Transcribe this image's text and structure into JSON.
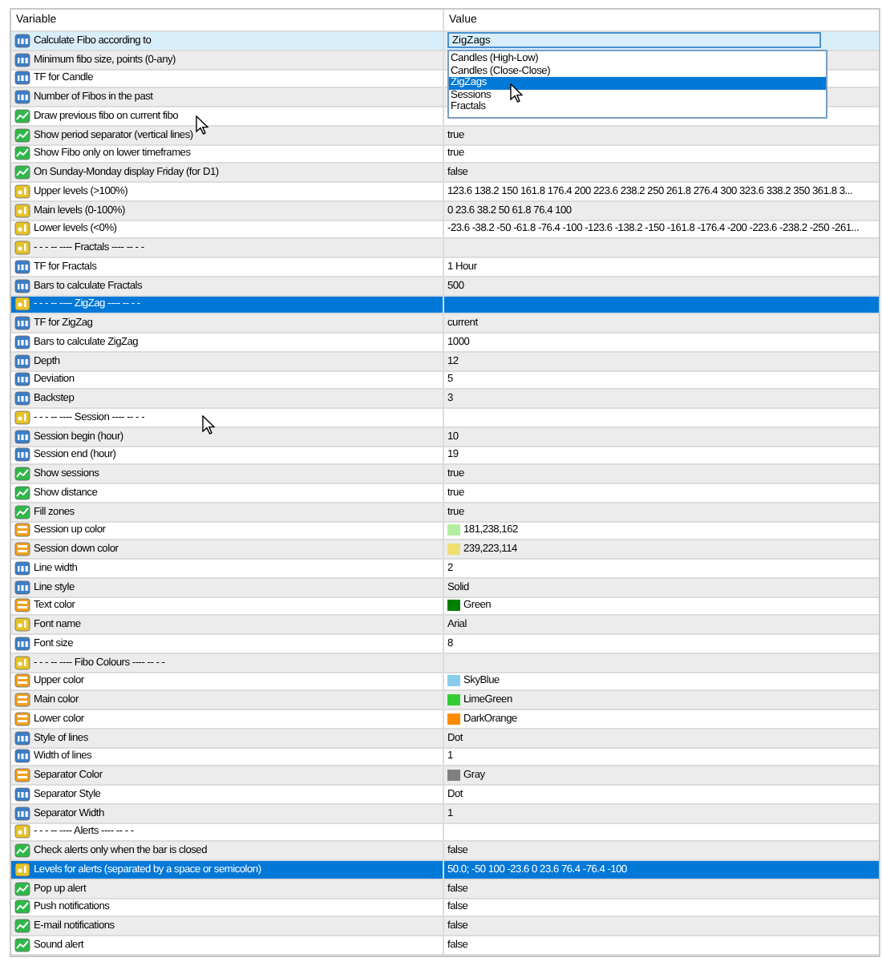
{
  "table": {
    "columns": [
      "Variable",
      "Value"
    ],
    "rows": [
      {
        "kind": "enum",
        "name": "Calculate Fibo according to",
        "selected": false,
        "dropdown": {
          "value": "ZigZags",
          "options": [
            {
              "label": "Candles (High-Low)",
              "selected": false
            },
            {
              "label": "Candles (Close-Close)",
              "selected": false
            },
            {
              "label": "ZigZags",
              "selected": true
            },
            {
              "label": "Sessions",
              "selected": false
            },
            {
              "label": "Fractals",
              "selected": false
            }
          ]
        }
      },
      {
        "kind": "int",
        "name": "Minimum fibo size, points (0-any)",
        "selected": false
      },
      {
        "kind": "enum",
        "name": "TF for Candle",
        "selected": false
      },
      {
        "kind": "int",
        "name": "Number of Fibos in the past",
        "selected": false
      },
      {
        "kind": "bool",
        "name": "Draw previous fibo on current fibo",
        "selected": false
      },
      {
        "kind": "bool",
        "name": "Show period separator (vertical lines)",
        "value": "true",
        "selected": false
      },
      {
        "kind": "bool",
        "name": "Show Fibo only on lower timeframes",
        "value": "true",
        "selected": false
      },
      {
        "kind": "bool",
        "name": "On Sunday-Monday display Friday (for D1)",
        "value": "false",
        "selected": false
      },
      {
        "kind": "str",
        "name": "Upper levels (>100%)",
        "value": "123.6 138.2 150 161.8 176.4 200 223.6 238.2 250 261.8 276.4 300 323.6 338.2 350 361.8 3...",
        "selected": false
      },
      {
        "kind": "str",
        "name": "Main levels (0-100%)",
        "value": "0 23.6 38.2 50 61.8 76.4 100",
        "selected": false
      },
      {
        "kind": "str",
        "name": "Lower levels (<0%)",
        "value": "-23.6 -38.2 -50 -61.8 -76.4 -100 -123.6 -138.2 -150 -161.8 -176.4 -200 -223.6 -238.2 -250 -261...",
        "selected": false
      },
      {
        "kind": "str",
        "name": "- - - -- ---- Fractals ---- -- - -",
        "selected": false
      },
      {
        "kind": "enum",
        "name": "TF for Fractals",
        "value": "1 Hour",
        "selected": false
      },
      {
        "kind": "int",
        "name": "Bars to calculate Fractals",
        "value": "500",
        "selected": false
      },
      {
        "kind": "str",
        "name": "- - - -- ---- ZigZag ---- -- - -",
        "selected": true
      },
      {
        "kind": "enum",
        "name": "TF for ZigZag",
        "value": "current",
        "selected": false
      },
      {
        "kind": "int",
        "name": "Bars to calculate ZigZag",
        "value": "1000",
        "selected": false
      },
      {
        "kind": "int",
        "name": "Depth",
        "value": "12",
        "selected": false
      },
      {
        "kind": "int",
        "name": "Deviation",
        "value": "5",
        "selected": false
      },
      {
        "kind": "int",
        "name": "Backstep",
        "value": "3",
        "selected": false
      },
      {
        "kind": "str",
        "name": "- - - -- ---- Session ---- -- - -",
        "selected": false
      },
      {
        "kind": "int",
        "name": "Session begin (hour)",
        "value": "10",
        "selected": false
      },
      {
        "kind": "int",
        "name": "Session end (hour)",
        "value": "19",
        "selected": false
      },
      {
        "kind": "bool",
        "name": "Show sessions",
        "value": "true",
        "selected": false
      },
      {
        "kind": "bool",
        "name": "Show distance",
        "value": "true",
        "selected": false
      },
      {
        "kind": "bool",
        "name": "Fill zones",
        "value": "true",
        "selected": false
      },
      {
        "kind": "color",
        "name": "Session up color",
        "value": "181,238,162",
        "color": "#b5eea2",
        "selected": false
      },
      {
        "kind": "color",
        "name": "Session down color",
        "value": "239,223,114",
        "color": "#efdf72",
        "selected": false
      },
      {
        "kind": "int",
        "name": "Line width",
        "value": "2",
        "selected": false
      },
      {
        "kind": "enum",
        "name": "Line style",
        "value": "Solid",
        "selected": false
      },
      {
        "kind": "color",
        "name": "Text color",
        "value": "Green",
        "color": "#008000",
        "selected": false
      },
      {
        "kind": "str",
        "name": "Font name",
        "value": "Arial",
        "selected": false
      },
      {
        "kind": "int",
        "name": "Font size",
        "value": "8",
        "selected": false
      },
      {
        "kind": "str",
        "name": "- - - -- ---- Fibo Colours ---- -- - -",
        "selected": false
      },
      {
        "kind": "color",
        "name": "Upper color",
        "value": "SkyBlue",
        "color": "#87ceeb",
        "selected": false
      },
      {
        "kind": "color",
        "name": "Main color",
        "value": "LimeGreen",
        "color": "#32cd32",
        "selected": false
      },
      {
        "kind": "color",
        "name": "Lower color",
        "value": "DarkOrange",
        "color": "#ff8c00",
        "selected": false
      },
      {
        "kind": "enum",
        "name": "Style of lines",
        "value": "Dot",
        "selected": false
      },
      {
        "kind": "int",
        "name": "Width of lines",
        "value": "1",
        "selected": false
      },
      {
        "kind": "color",
        "name": "Separator Color",
        "value": "Gray",
        "color": "#808080",
        "selected": false
      },
      {
        "kind": "enum",
        "name": "Separator Style",
        "value": "Dot",
        "selected": false
      },
      {
        "kind": "int",
        "name": "Separator Width",
        "value": "1",
        "selected": false
      },
      {
        "kind": "str",
        "name": "- - - -- ---- Alerts ---- -- - -",
        "selected": false
      },
      {
        "kind": "bool",
        "name": "Check alerts only when the bar is closed",
        "value": "false",
        "selected": false
      },
      {
        "kind": "str",
        "name": "Levels for alerts (separated by a space or semicolon)",
        "value": "50.0; -50 100 -23.6 0 23.6 76.4 -76.4 -100",
        "selected": true
      },
      {
        "kind": "bool",
        "name": "Pop up alert",
        "value": "false",
        "selected": false
      },
      {
        "kind": "bool",
        "name": "Push notifications",
        "value": "false",
        "selected": false
      },
      {
        "kind": "bool",
        "name": "E-mail notifications",
        "value": "false",
        "selected": false
      },
      {
        "kind": "bool",
        "name": "Sound alert",
        "value": "false",
        "selected": false
      }
    ]
  }
}
